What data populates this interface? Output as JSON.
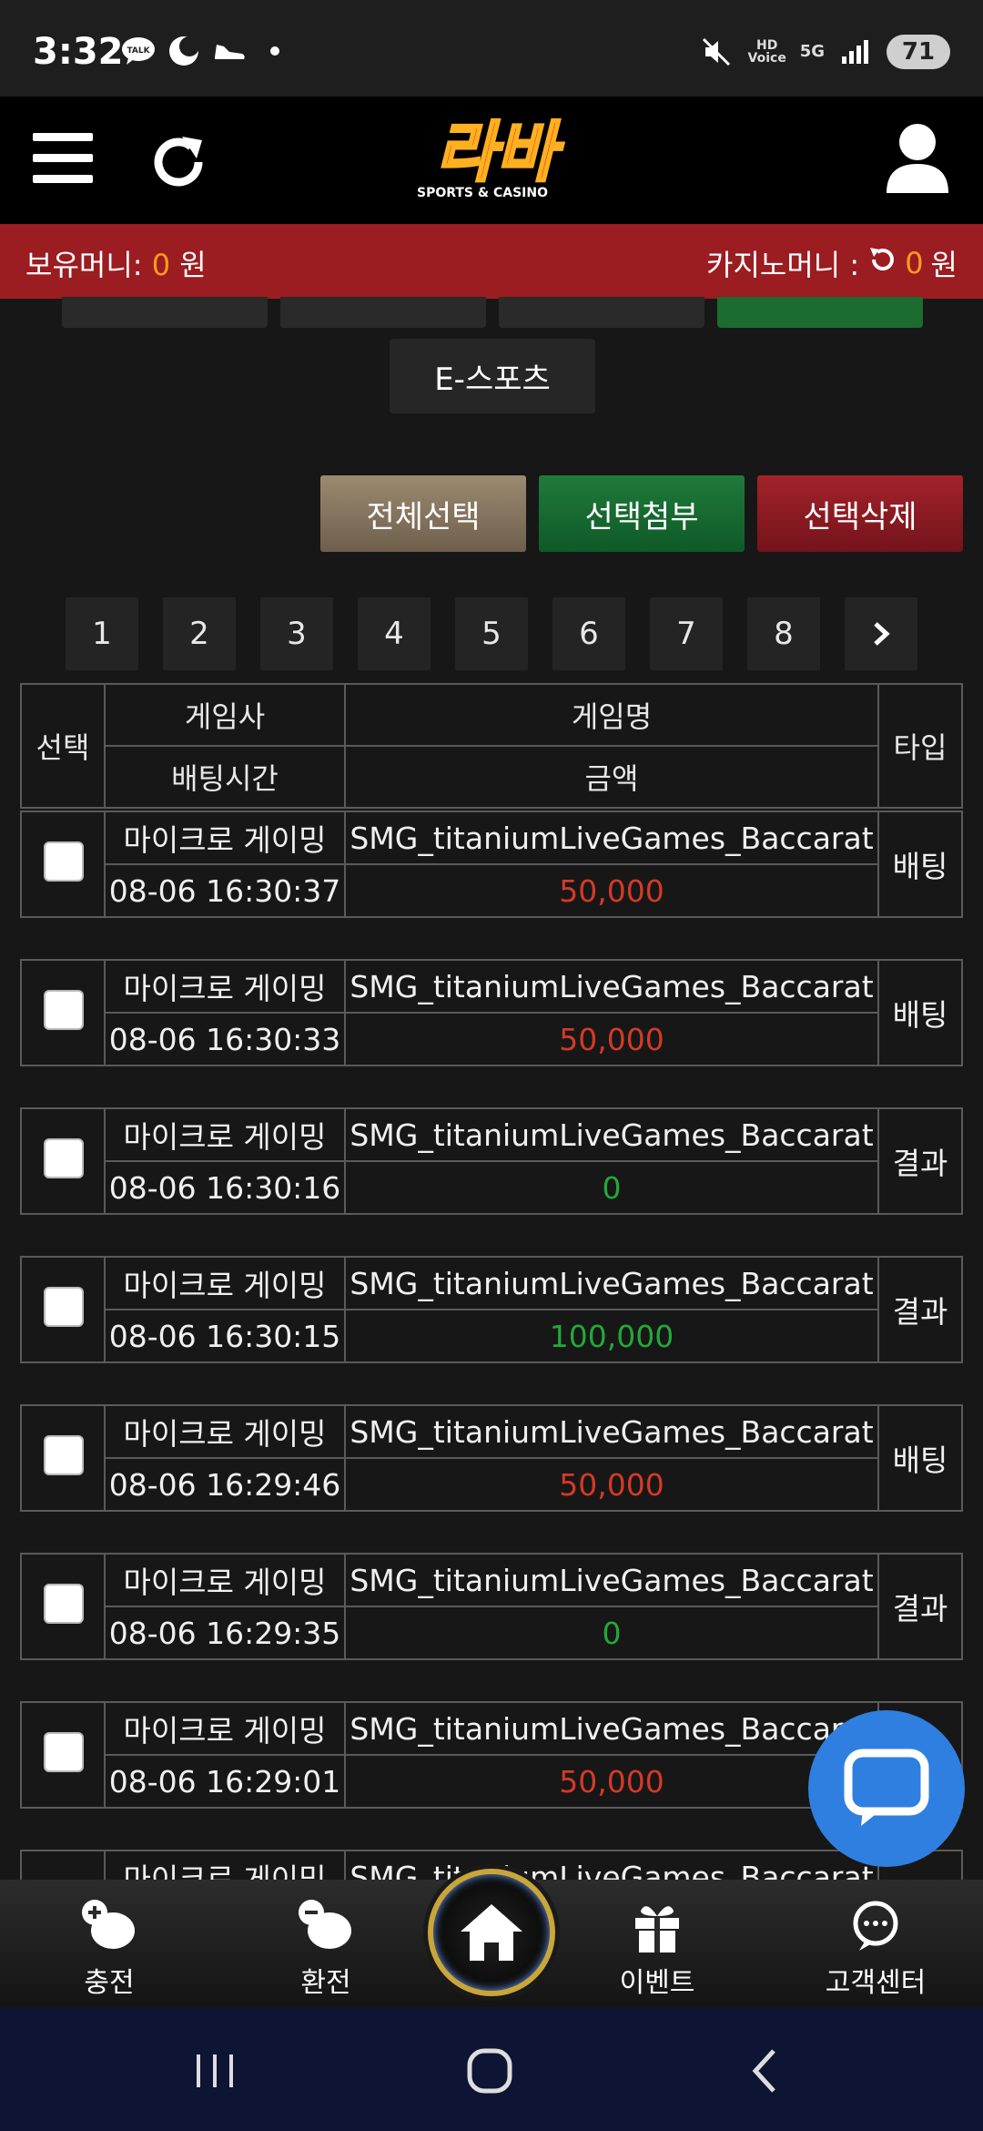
{
  "status": {
    "time": "3:32",
    "hd_voice": "HD Voice",
    "network": "5G",
    "battery": "71"
  },
  "header": {
    "logo_main": "라바",
    "logo_sub": "SPORTS & CASINO"
  },
  "money": {
    "hold_label": "보유머니:",
    "hold_amount": "0",
    "hold_unit": "원",
    "casino_label": "카지노머니 :",
    "casino_amount": "0",
    "casino_unit": "원"
  },
  "category": {
    "esports_label": "E-스포츠"
  },
  "actions": {
    "select_all": "전체선택",
    "attach": "선택첨부",
    "delete": "선택삭제"
  },
  "pagination": {
    "pages": [
      "1",
      "2",
      "3",
      "4",
      "5",
      "6",
      "7",
      "8"
    ]
  },
  "table": {
    "headers": {
      "select": "선택",
      "provider": "게임사",
      "bet_time": "배팅시간",
      "game_name": "게임명",
      "amount": "금액",
      "type": "타입"
    },
    "rows": [
      {
        "provider": "마이크로 게이밍",
        "time": "08-06 16:30:37",
        "game": "SMG_titaniumLiveGames_Baccarat",
        "amount": "50,000",
        "type": "배팅",
        "amount_color": "neg"
      },
      {
        "provider": "마이크로 게이밍",
        "time": "08-06 16:30:33",
        "game": "SMG_titaniumLiveGames_Baccarat",
        "amount": "50,000",
        "type": "배팅",
        "amount_color": "neg"
      },
      {
        "provider": "마이크로 게이밍",
        "time": "08-06 16:30:16",
        "game": "SMG_titaniumLiveGames_Baccarat",
        "amount": "0",
        "type": "결과",
        "amount_color": "pos"
      },
      {
        "provider": "마이크로 게이밍",
        "time": "08-06 16:30:15",
        "game": "SMG_titaniumLiveGames_Baccarat",
        "amount": "100,000",
        "type": "결과",
        "amount_color": "pos"
      },
      {
        "provider": "마이크로 게이밍",
        "time": "08-06 16:29:46",
        "game": "SMG_titaniumLiveGames_Baccarat",
        "amount": "50,000",
        "type": "배팅",
        "amount_color": "neg"
      },
      {
        "provider": "마이크로 게이밍",
        "time": "08-06 16:29:35",
        "game": "SMG_titaniumLiveGames_Baccarat",
        "amount": "0",
        "type": "결과",
        "amount_color": "pos"
      },
      {
        "provider": "마이크로 게이밍",
        "time": "08-06 16:29:01",
        "game": "SMG_titaniumLiveGames_Baccarat",
        "amount": "50,000",
        "type": "",
        "amount_color": "neg"
      },
      {
        "provider": "마이크로 게이밍",
        "time": "",
        "game": "SMG_titaniumLiveGames_Baccarat",
        "amount": "",
        "type": "",
        "amount_color": "neg"
      }
    ]
  },
  "bottom_nav": {
    "charge": "충전",
    "exchange": "환전",
    "event": "이벤트",
    "support": "고객센터"
  },
  "colors": {
    "money_bar": "#9b1c21",
    "amount_highlight": "#ff9a1f",
    "negative": "#d43a26",
    "positive": "#22a83a",
    "chat": "#2f7fe0"
  }
}
